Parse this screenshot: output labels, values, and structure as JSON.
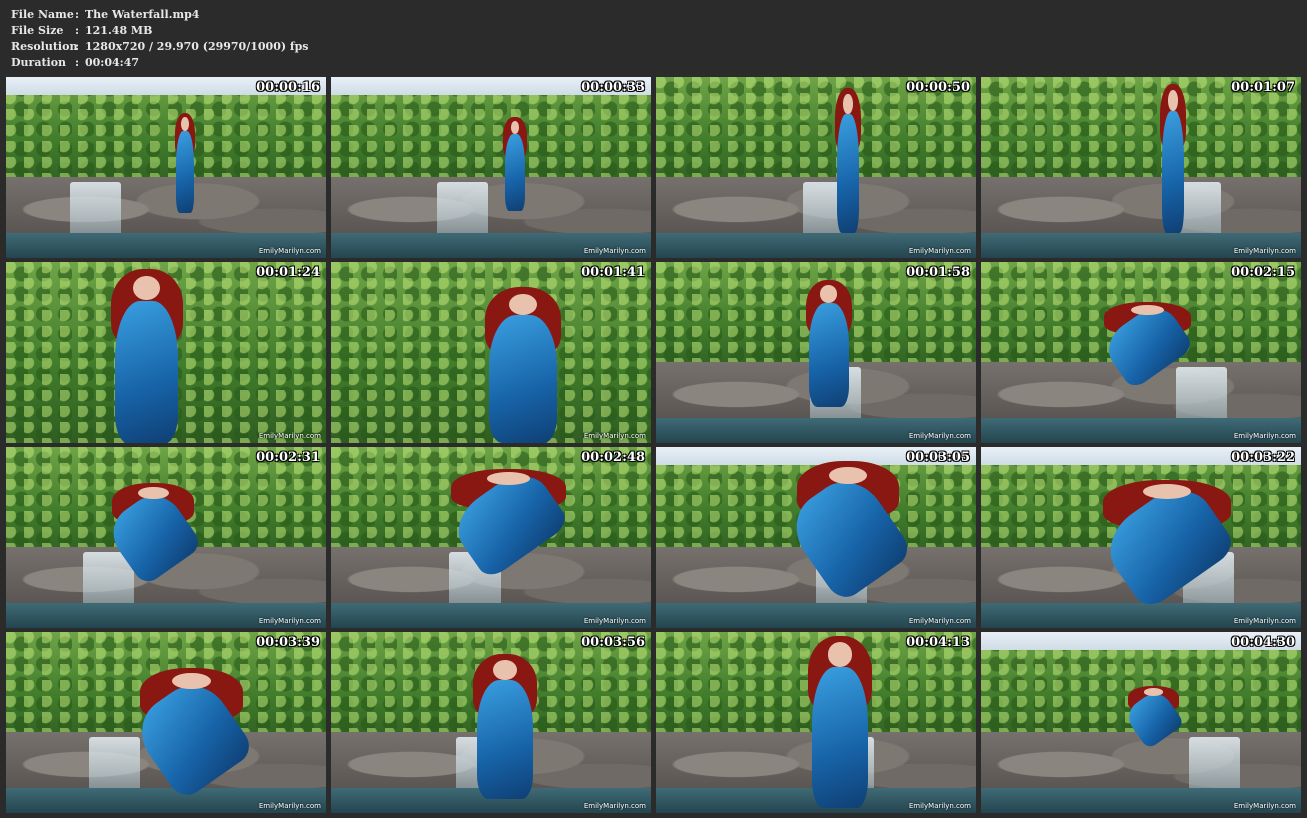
{
  "file_info": {
    "name_key": "File Name",
    "name_value": "The Waterfall.mp4",
    "size_key": "File Size",
    "size_value": "121.48 MB",
    "resolution_key": "Resolution",
    "resolution_value": "1280x720 / 29.970 (29970/1000) fps",
    "duration_key": "Duration",
    "duration_value": "00:04:47",
    "separator": ":"
  },
  "thumbnails": [
    {
      "timestamp": "00:00:16",
      "watermark": "EmilyMarilyn.com",
      "scene": "wide"
    },
    {
      "timestamp": "00:00:33",
      "watermark": "EmilyMarilyn.com",
      "scene": "wide"
    },
    {
      "timestamp": "00:00:50",
      "watermark": "EmilyMarilyn.com",
      "scene": "rocks"
    },
    {
      "timestamp": "00:01:07",
      "watermark": "EmilyMarilyn.com",
      "scene": "rocks"
    },
    {
      "timestamp": "00:01:24",
      "watermark": "EmilyMarilyn.com",
      "scene": "closeup"
    },
    {
      "timestamp": "00:01:41",
      "watermark": "EmilyMarilyn.com",
      "scene": "closeup"
    },
    {
      "timestamp": "00:01:58",
      "watermark": "EmilyMarilyn.com",
      "scene": "rocks"
    },
    {
      "timestamp": "00:02:15",
      "watermark": "EmilyMarilyn.com",
      "scene": "rocks"
    },
    {
      "timestamp": "00:02:31",
      "watermark": "EmilyMarilyn.com",
      "scene": "rocks"
    },
    {
      "timestamp": "00:02:48",
      "watermark": "EmilyMarilyn.com",
      "scene": "rocks"
    },
    {
      "timestamp": "00:03:05",
      "watermark": "EmilyMarilyn.com",
      "scene": "wide"
    },
    {
      "timestamp": "00:03:22",
      "watermark": "EmilyMarilyn.com",
      "scene": "wide"
    },
    {
      "timestamp": "00:03:39",
      "watermark": "EmilyMarilyn.com",
      "scene": "rocks"
    },
    {
      "timestamp": "00:03:56",
      "watermark": "EmilyMarilyn.com",
      "scene": "rocks"
    },
    {
      "timestamp": "00:04:13",
      "watermark": "EmilyMarilyn.com",
      "scene": "rocks"
    },
    {
      "timestamp": "00:04:30",
      "watermark": "EmilyMarilyn.com",
      "scene": "wide"
    }
  ]
}
